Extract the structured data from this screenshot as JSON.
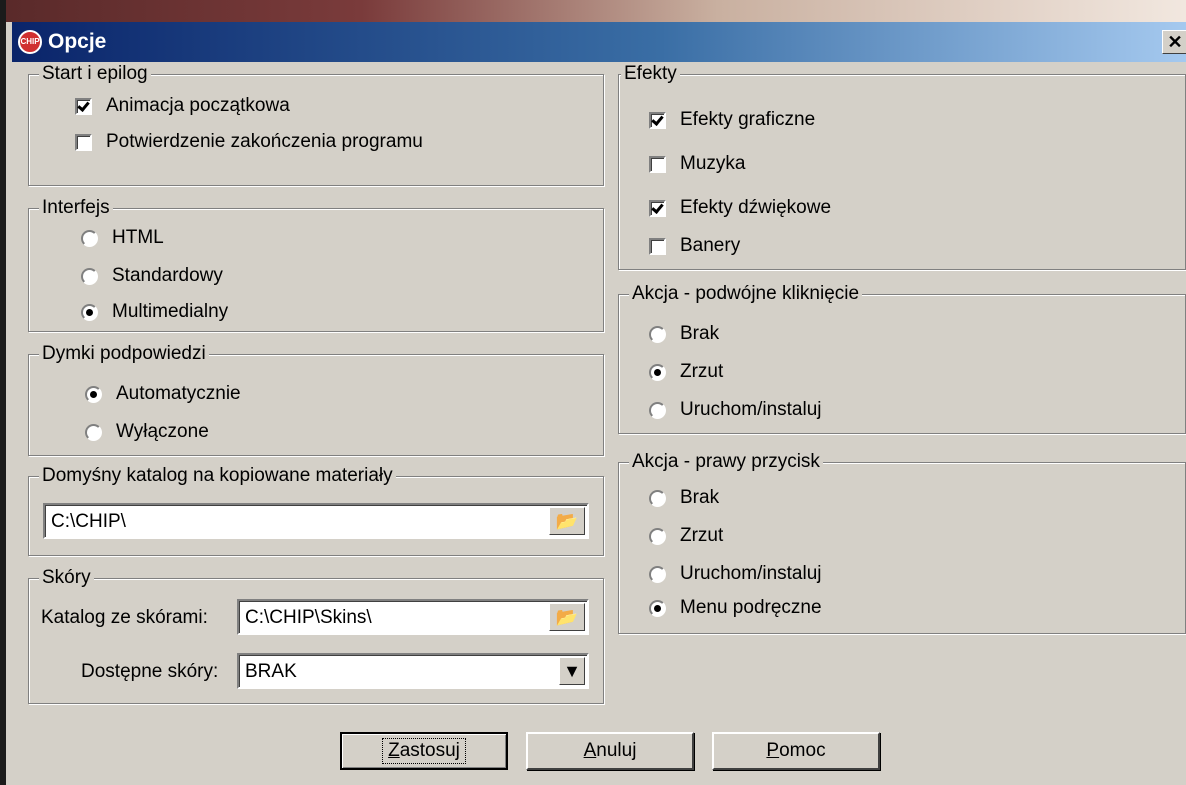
{
  "window": {
    "title": "Opcje",
    "logo_text": "CHIP",
    "close_symbol": "✕"
  },
  "start": {
    "legend": "Start i epilog",
    "items": [
      {
        "label": "Animacja początkowa",
        "checked": true
      },
      {
        "label": "Potwierdzenie zakończenia programu",
        "checked": false
      }
    ]
  },
  "interface": {
    "legend": "Interfejs",
    "options": [
      {
        "label": "HTML",
        "selected": false
      },
      {
        "label": "Standardowy",
        "selected": false
      },
      {
        "label": "Multimedialny",
        "selected": true
      }
    ]
  },
  "tooltips": {
    "legend": "Dymki podpowiedzi",
    "options": [
      {
        "label": "Automatycznie",
        "selected": true
      },
      {
        "label": "Wyłączone",
        "selected": false
      }
    ]
  },
  "default_dir": {
    "legend": "Domyśny katalog na kopiowane materiały",
    "value": "C:\\CHIP\\",
    "browse_icon": "folder-open-icon"
  },
  "skins": {
    "legend": "Skóry",
    "dir_label": "Katalog ze skórami:",
    "dir_value": "C:\\CHIP\\Skins\\",
    "available_label": "Dostępne skóry:",
    "available_value": "BRAK"
  },
  "effects": {
    "legend": "Efekty",
    "items": [
      {
        "label": "Efekty graficzne",
        "checked": true
      },
      {
        "label": "Muzyka",
        "checked": false
      },
      {
        "label": "Efekty dźwiękowe",
        "checked": true
      },
      {
        "label": "Banery",
        "checked": false
      }
    ]
  },
  "double_click": {
    "legend": "Akcja - podwójne kliknięcie",
    "options": [
      {
        "label": "Brak",
        "selected": false
      },
      {
        "label": "Zrzut",
        "selected": true
      },
      {
        "label": "Uruchom/instaluj",
        "selected": false
      }
    ]
  },
  "right_click": {
    "legend": "Akcja - prawy przycisk",
    "options": [
      {
        "label": "Brak",
        "selected": false
      },
      {
        "label": "Zrzut",
        "selected": false
      },
      {
        "label": "Uruchom/instaluj",
        "selected": false
      },
      {
        "label": "Menu podręczne",
        "selected": true
      }
    ]
  },
  "buttons": {
    "apply": {
      "accel": "Z",
      "rest": "astosuj"
    },
    "cancel": {
      "accel": "A",
      "rest": "nuluj"
    },
    "help": {
      "accel": "P",
      "rest": "omoc"
    }
  }
}
